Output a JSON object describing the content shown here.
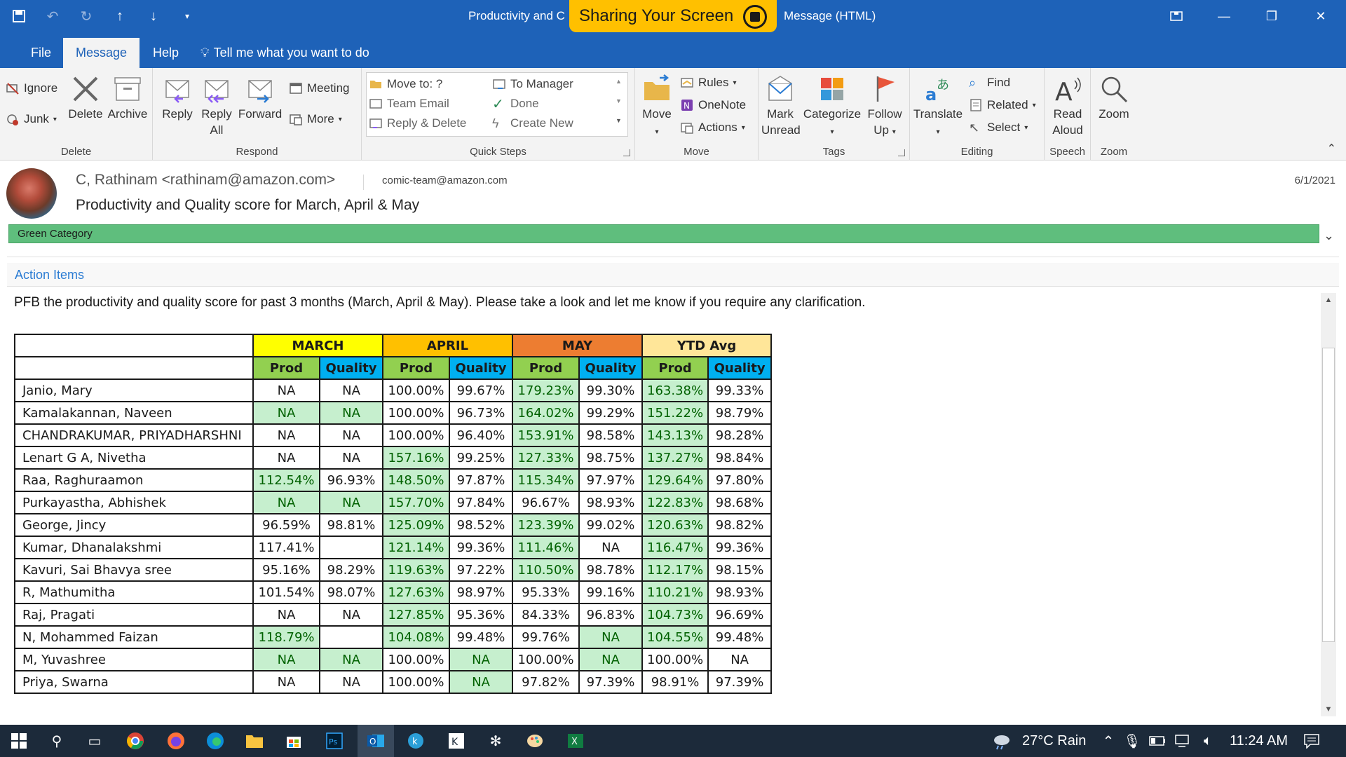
{
  "titlebar": {
    "title_left": "Productivity and C",
    "sharing_label": "Sharing Your Screen",
    "title_right": "Message (HTML)"
  },
  "tabs": [
    {
      "label": "File"
    },
    {
      "label": "Message",
      "active": true
    },
    {
      "label": "Help"
    }
  ],
  "tell_me": "Tell me what you want to do",
  "ribbon": {
    "delete_group": {
      "label": "Delete",
      "ignore": "Ignore",
      "junk": "Junk",
      "delete": "Delete",
      "archive": "Archive"
    },
    "respond_group": {
      "label": "Respond",
      "reply": "Reply",
      "reply_all_1": "Reply",
      "reply_all_2": "All",
      "forward": "Forward",
      "meeting": "Meeting",
      "more": "More"
    },
    "quick_steps": {
      "label": "Quick Steps",
      "items": [
        "Move to: ?",
        "Team Email",
        "Reply & Delete",
        "To Manager",
        "Done",
        "Create New"
      ]
    },
    "move_group": {
      "label": "Move",
      "move": "Move",
      "rules": "Rules",
      "onenote": "OneNote",
      "actions": "Actions"
    },
    "tags_group": {
      "label": "Tags",
      "mark_unread_1": "Mark",
      "mark_unread_2": "Unread",
      "categorize": "Categorize",
      "follow_up_1": "Follow",
      "follow_up_2": "Up"
    },
    "editing_group": {
      "label": "Editing",
      "translate": "Translate",
      "find": "Find",
      "related": "Related",
      "select": "Select"
    },
    "speech_group": {
      "label": "Speech",
      "read_aloud_1": "Read",
      "read_aloud_2": "Aloud"
    },
    "zoom_group": {
      "label": "Zoom",
      "zoom": "Zoom"
    }
  },
  "message": {
    "sender": "C, Rathinam <rathinam@amazon.com>",
    "to": "comic-team@amazon.com",
    "date": "6/1/2021",
    "subject": "Productivity and Quality score for March, April & May",
    "category": "Green Category",
    "action_items": "Action Items",
    "body": "PFB the productivity and quality score for past 3 months (March, April & May). Please take a look and let me know if you require any clarification."
  },
  "table": {
    "months": [
      "MARCH",
      "APRIL",
      "MAY",
      "YTD Avg"
    ],
    "sub_prod": "Prod",
    "sub_quality": "Quality",
    "rows": [
      {
        "name": "Janio, Mary",
        "cells": [
          "NA",
          "NA",
          "100.00%",
          "99.67%",
          "179.23%",
          "99.30%",
          "163.38%",
          "99.33%"
        ],
        "green": [
          4,
          6
        ]
      },
      {
        "name": "Kamalakannan, Naveen",
        "cells": [
          "NA",
          "NA",
          "100.00%",
          "96.73%",
          "164.02%",
          "99.29%",
          "151.22%",
          "98.79%"
        ],
        "green": [
          0,
          1,
          4,
          6
        ]
      },
      {
        "name": "CHANDRAKUMAR, PRIYADHARSHNI",
        "cells": [
          "NA",
          "NA",
          "100.00%",
          "96.40%",
          "153.91%",
          "98.58%",
          "143.13%",
          "98.28%"
        ],
        "green": [
          4,
          6
        ]
      },
      {
        "name": "Lenart G A, Nivetha",
        "cells": [
          "NA",
          "NA",
          "157.16%",
          "99.25%",
          "127.33%",
          "98.75%",
          "137.27%",
          "98.84%"
        ],
        "green": [
          2,
          4,
          6
        ]
      },
      {
        "name": "Raa, Raghuraamon",
        "cells": [
          "112.54%",
          "96.93%",
          "148.50%",
          "97.87%",
          "115.34%",
          "97.97%",
          "129.64%",
          "97.80%"
        ],
        "green": [
          0,
          2,
          4,
          6
        ]
      },
      {
        "name": "Purkayastha, Abhishek",
        "cells": [
          "NA",
          "NA",
          "157.70%",
          "97.84%",
          "96.67%",
          "98.93%",
          "122.83%",
          "98.68%"
        ],
        "green": [
          0,
          1,
          2,
          6
        ]
      },
      {
        "name": "George, Jincy",
        "cells": [
          "96.59%",
          "98.81%",
          "125.09%",
          "98.52%",
          "123.39%",
          "99.02%",
          "120.63%",
          "98.82%"
        ],
        "green": [
          2,
          4,
          6
        ]
      },
      {
        "name": "Kumar, Dhanalakshmi",
        "cells": [
          "117.41%",
          "",
          "121.14%",
          "99.36%",
          "111.46%",
          "NA",
          "116.47%",
          "99.36%"
        ],
        "green": [
          2,
          4,
          6
        ]
      },
      {
        "name": "Kavuri, Sai Bhavya sree",
        "cells": [
          "95.16%",
          "98.29%",
          "119.63%",
          "97.22%",
          "110.50%",
          "98.78%",
          "112.17%",
          "98.15%"
        ],
        "green": [
          2,
          4,
          6
        ]
      },
      {
        "name": "R, Mathumitha",
        "cells": [
          "101.54%",
          "98.07%",
          "127.63%",
          "98.97%",
          "95.33%",
          "99.16%",
          "110.21%",
          "98.93%"
        ],
        "green": [
          2,
          6
        ]
      },
      {
        "name": "Raj, Pragati",
        "cells": [
          "NA",
          "NA",
          "127.85%",
          "95.36%",
          "84.33%",
          "96.83%",
          "104.73%",
          "96.69%"
        ],
        "green": [
          2,
          6
        ]
      },
      {
        "name": "N, Mohammed Faizan",
        "cells": [
          "118.79%",
          "",
          "104.08%",
          "99.48%",
          "99.76%",
          "NA",
          "104.55%",
          "99.48%"
        ],
        "green": [
          0,
          2,
          5,
          6
        ]
      },
      {
        "name": "M, Yuvashree",
        "cells": [
          "NA",
          "NA",
          "100.00%",
          "NA",
          "100.00%",
          "NA",
          "100.00%",
          "NA"
        ],
        "green": [
          0,
          1,
          3,
          5
        ]
      },
      {
        "name": "Priya, Swarna",
        "cells": [
          "NA",
          "NA",
          "100.00%",
          "NA",
          "97.82%",
          "97.39%",
          "98.91%",
          "97.39%"
        ],
        "green": [
          3
        ]
      }
    ]
  },
  "taskbar": {
    "weather": "27°C  Rain",
    "time": "11:24 AM"
  },
  "colors": {
    "accent": "#1e62b8",
    "sharing": "#ffc000",
    "category_green": "#5fbe7d",
    "march": "#ffff00",
    "april": "#ffc000",
    "may": "#ed7d31",
    "ytd": "#ffe699",
    "prod": "#92d050",
    "quality": "#00b0f0",
    "good_fill": "#c6efce",
    "good_text": "#006100"
  }
}
